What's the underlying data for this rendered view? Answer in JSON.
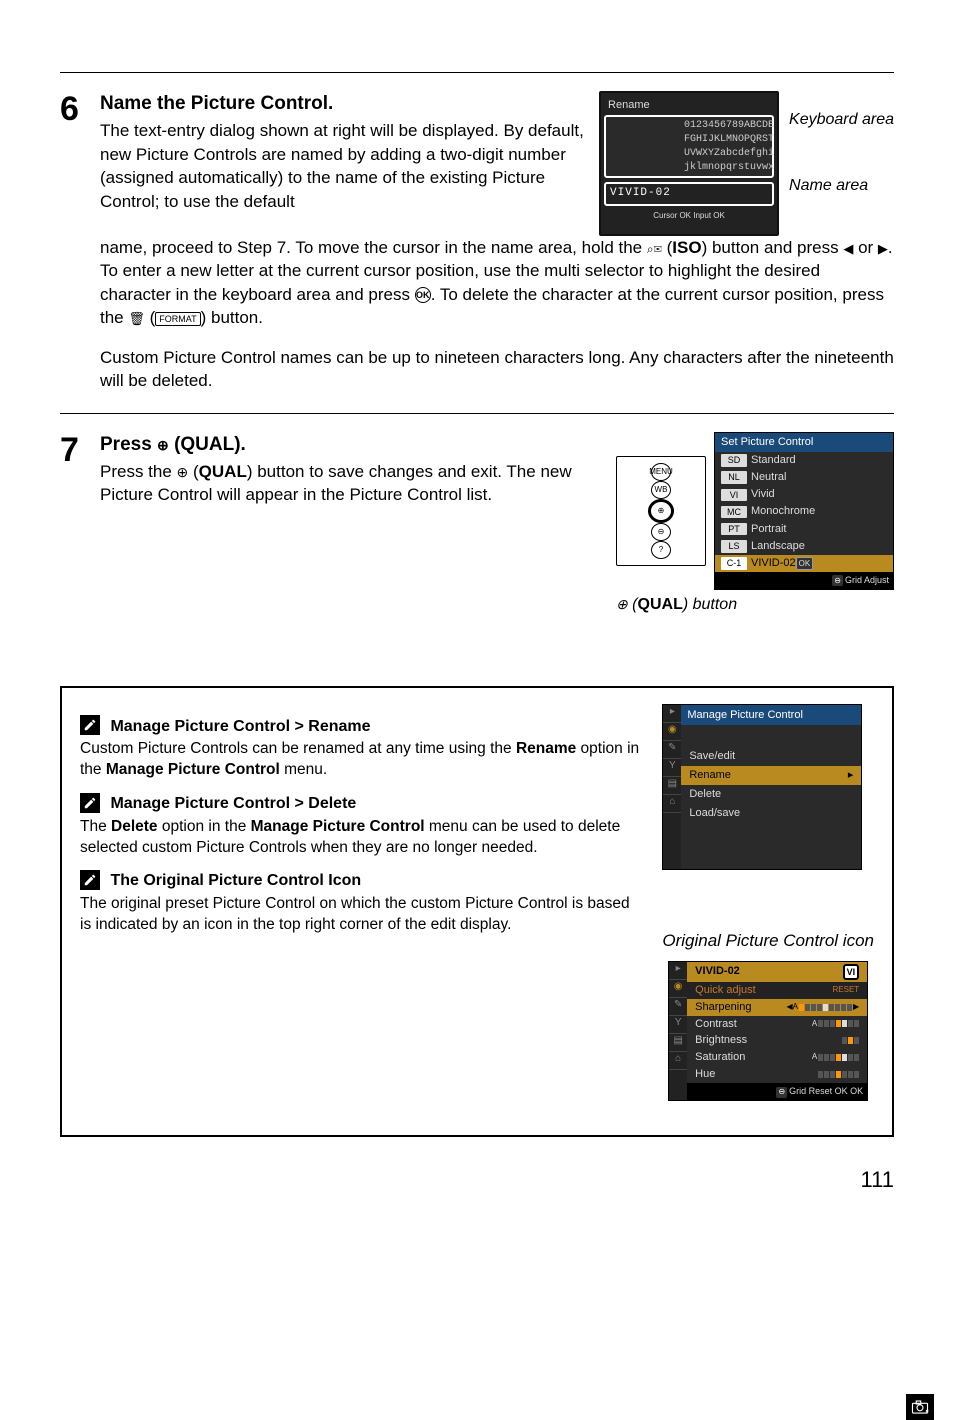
{
  "step6": {
    "number": "6",
    "title": "Name the Picture Control.",
    "para1a": "The text-entry dialog shown at right will be displayed.  By default, new Picture Controls are named by adding a two-digit number (assigned automatically) to the name of the existing Picture Control; to use the default ",
    "para1b": "name, proceed to Step 7.  To move the cursor in the name area, hold the ",
    "iso_label": "ISO",
    "para1c": ") button and press ",
    "para1d": " or ",
    "para1e": ".  To enter a new letter at the current cursor position, use the multi selector to highlight the desired character in the keyboard area and press ",
    "ok_symbol": "OK",
    "para1f": ".  To delete the character at the current cursor position, press the ",
    "format_label": "FORMAT",
    "para1g": ") button.",
    "para2": "Custom Picture Control names can be up to nineteen characters long.  Any characters after the nineteenth will be deleted.",
    "keyboard": {
      "screen_title": "Rename",
      "row1": "0123456789ABCDE",
      "row2": "FGHIJKLMNOPQRST",
      "row3": "UVWXYZabcdefghi",
      "row4": "jklmnopqrstuvwx",
      "name_value": "VIVID-02",
      "footer": "Cursor   OK Input    OK",
      "label_keyboard": "Keyboard area",
      "label_name": "Name area"
    }
  },
  "step7": {
    "number": "7",
    "title_prefix": "Press ",
    "title_qual": "QUAL",
    "title_suffix": ".",
    "body_a": "Press the ",
    "body_b": " (",
    "body_c": ") button to save changes and exit.  The new Picture Control will appear in the Picture Control list.",
    "qual_label": "QUAL",
    "btn_caption_prefix": " (",
    "btn_caption_bold": "QUAL",
    "btn_caption_suffix": ") button",
    "spc": {
      "header": "Set Picture Control",
      "items": [
        {
          "badge": "SD",
          "label": "Standard"
        },
        {
          "badge": "NL",
          "label": "Neutral"
        },
        {
          "badge": "VI",
          "label": "Vivid"
        },
        {
          "badge": "MC",
          "label": "Monochrome"
        },
        {
          "badge": "PT",
          "label": "Portrait"
        },
        {
          "badge": "LS",
          "label": "Landscape"
        },
        {
          "badge": "C-1",
          "label": "VIVID-02"
        }
      ],
      "ok": "OK",
      "footer": "Grid    Adjust"
    }
  },
  "info": {
    "h1_prefix": "Manage Picture Control",
    "gt": " > ",
    "h1_tail": "Rename",
    "p1a": "Custom Picture Controls can be renamed at any time using the ",
    "p1b": "Rename",
    "p1c": " option in the ",
    "p1d": "Manage Picture Control",
    "p1e": " menu.",
    "h2_prefix": "Manage Picture Control",
    "h2_tail": "Delete",
    "p2a": "The ",
    "p2b": "Delete",
    "p2c": " option in the ",
    "p2d": "Manage Picture Control",
    "p2e": " menu can be used to delete selected custom Picture Controls when they are no longer needed.",
    "h3": "The Original Picture Control Icon",
    "p3": "The original preset Picture Control on which the custom Picture Control is based is indicated by an icon in the top right corner of the edit display.",
    "mpc": {
      "header": "Manage Picture Control",
      "items": [
        "Save/edit",
        "Rename",
        "Delete",
        "Load/save"
      ]
    },
    "orig_label": "Original Picture Control icon",
    "vivid": {
      "header": "VIVID-02",
      "corner_badge": "VI",
      "rows": [
        {
          "label": "Quick adjust",
          "type": "qk"
        },
        {
          "label": "Sharpening",
          "type": "hl"
        },
        {
          "label": "Contrast",
          "type": ""
        },
        {
          "label": "Brightness",
          "type": ""
        },
        {
          "label": "Saturation",
          "type": ""
        },
        {
          "label": "Hue",
          "type": ""
        }
      ],
      "qk_reset": "RESET",
      "footer": "Grid    Reset   OK OK"
    }
  },
  "page_number": "111"
}
